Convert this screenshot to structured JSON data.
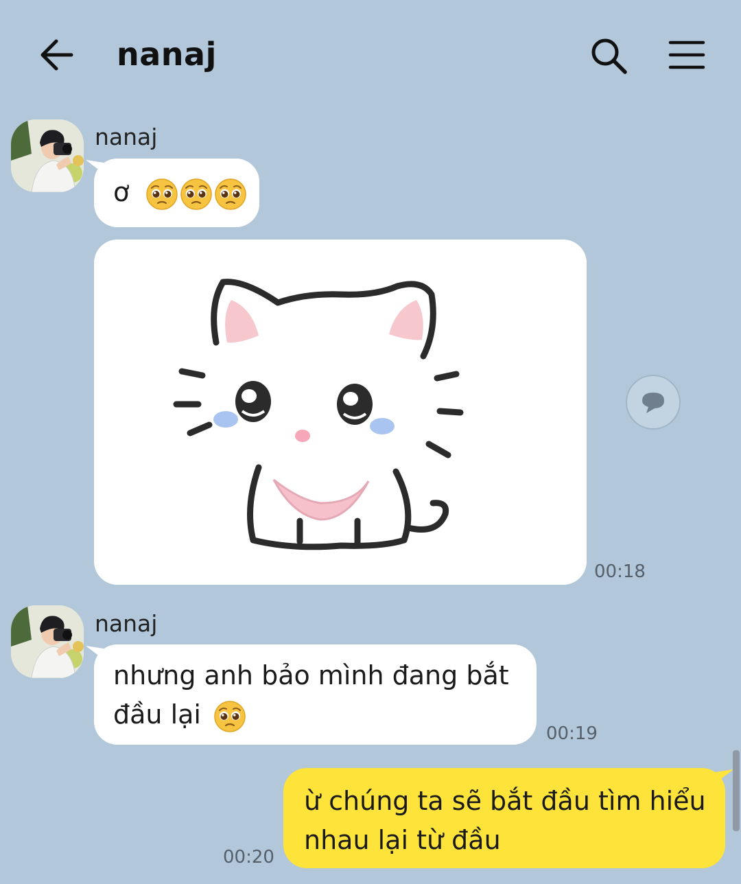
{
  "header": {
    "title": "nanaj",
    "back_icon": "arrow-left-icon",
    "search_icon": "search-icon",
    "menu_icon": "hamburger-menu-icon"
  },
  "messages": [
    {
      "sender": "nanaj",
      "text": "ơ",
      "emoji": "pleading-face",
      "emoji_count": 3
    },
    {
      "sender": "nanaj",
      "type": "sticker",
      "sticker": "crying-white-kitten",
      "time": "00:18"
    },
    {
      "sender": "nanaj",
      "line1": "nhưng anh bảo mình đang bắt",
      "line2": "đầu lại",
      "emoji": "pleading-face",
      "time": "00:19"
    },
    {
      "sender": "me",
      "line1": "ừ chúng ta sẽ bắt đầu tìm hiểu",
      "line2": "nhau lại từ đầu",
      "time": "00:20"
    }
  ],
  "colors": {
    "background": "#b2c7da",
    "incoming_bubble": "#ffffff",
    "outgoing_bubble": "#fee33a"
  }
}
